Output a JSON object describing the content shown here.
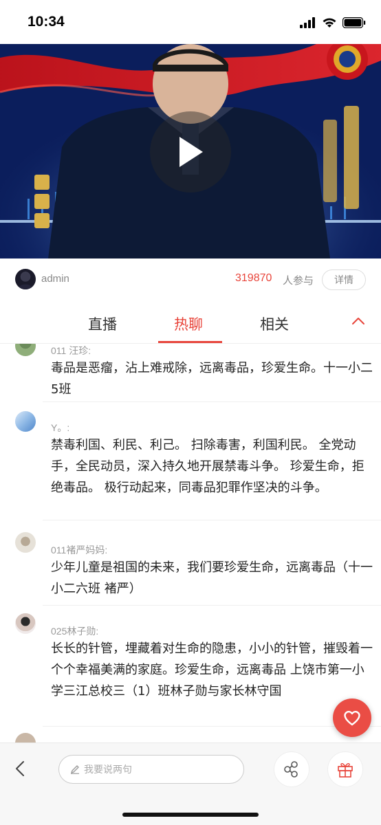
{
  "status": {
    "time": "10:34"
  },
  "video": {
    "state": "paused"
  },
  "info": {
    "author": "admin",
    "participants": "319870",
    "participants_label": "人参与",
    "detail_label": "详情"
  },
  "tabs": {
    "items": [
      "直播",
      "热聊",
      "相关"
    ],
    "active": "热聊"
  },
  "chat": {
    "messages": [
      {
        "name": "011 汪珍:",
        "text": "毒品是恶瘤，沾上难戒除，远离毒品，珍爱生命。十一小二5班"
      },
      {
        "name": "Y。:",
        "text": "禁毒利国、利民、利己。 扫除毒害，利国利民。 全党动手，全民动员，深入持久地开展禁毒斗争。 珍爱生命，拒绝毒品。 极行动起来，同毒品犯罪作坚决的斗争。"
      },
      {
        "name": "011褚严妈妈:",
        "text": "少年儿童是祖国的未来，我们要珍爱生命，远离毒品（十一小二六班 褚严）"
      },
      {
        "name": "025林子勋:",
        "text": "长长的针管，埋藏着对生命的隐患，小小的针管，摧毁着一个个幸福美满的家庭。珍爱生命，远离毒品 上饶市第一小学三江总校三（1）班林子勋与家长林守国"
      }
    ]
  },
  "bottom": {
    "comment_placeholder": "我要说两句"
  },
  "colors": {
    "accent": "#e8443a",
    "video_bg": "#0b1e5c"
  },
  "icons": [
    "signal-icon",
    "wifi-icon",
    "battery-icon",
    "play-icon",
    "chevron-up-icon",
    "heart-icon",
    "back-icon",
    "pen-icon",
    "share-icon",
    "gift-icon"
  ]
}
